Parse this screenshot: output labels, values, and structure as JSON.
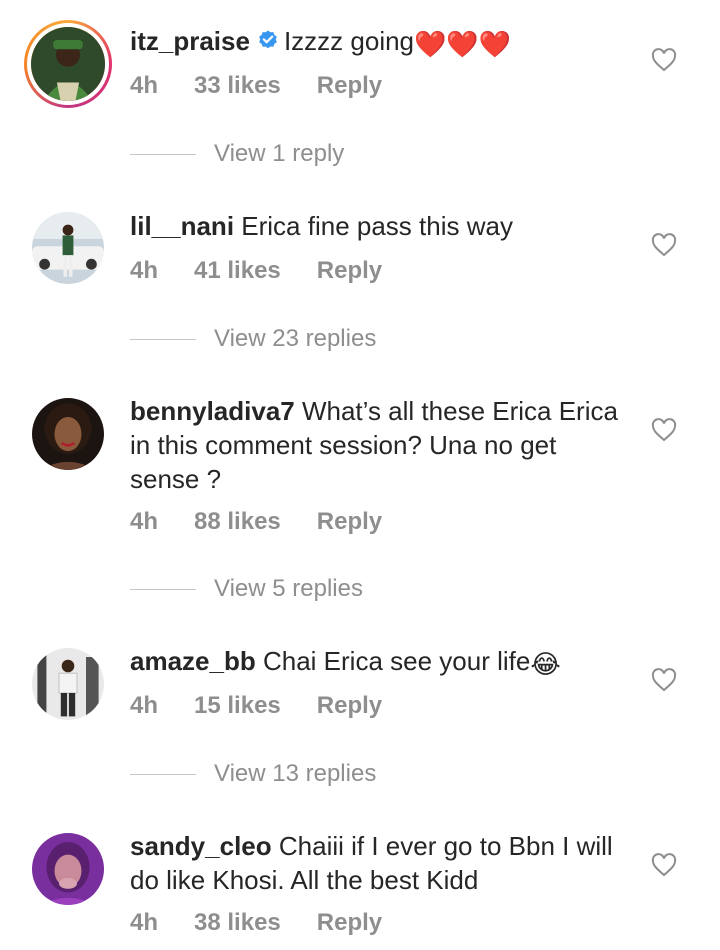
{
  "comments": [
    {
      "username": "itz_praise",
      "verified": true,
      "text": "Izzzz going",
      "emoji": "❤️❤️❤️",
      "time": "4h",
      "likes": "33 likes",
      "reply": "Reply",
      "view_replies": "View 1 reply"
    },
    {
      "username": "lil__nani",
      "verified": false,
      "text": "Erica fine pass this way",
      "emoji": "",
      "time": "4h",
      "likes": "41 likes",
      "reply": "Reply",
      "view_replies": "View 23 replies"
    },
    {
      "username": "bennyladiva7",
      "verified": false,
      "text": "What’s all these Erica Erica in this comment session? Una no get sense ?",
      "emoji": "",
      "time": "4h",
      "likes": "88 likes",
      "reply": "Reply",
      "view_replies": "View 5 replies"
    },
    {
      "username": "amaze_bb",
      "verified": false,
      "text": "Chai Erica see your life",
      "emoji": "😂",
      "time": "4h",
      "likes": "15 likes",
      "reply": "Reply",
      "view_replies": "View 13 replies"
    },
    {
      "username": "sandy_cleo",
      "verified": false,
      "text": "Chaiii if I ever go to Bbn I will do like Khosi. All the best Kidd",
      "emoji": "",
      "time": "4h",
      "likes": "38 likes",
      "reply": "Reply",
      "view_replies": ""
    }
  ],
  "icons": {
    "like": "heart-outline-icon",
    "verified": "verified-badge-icon"
  },
  "colors": {
    "text": "#262626",
    "meta": "#8e8e8e",
    "verified": "#3897f0",
    "heart_emoji": "#e02020"
  }
}
